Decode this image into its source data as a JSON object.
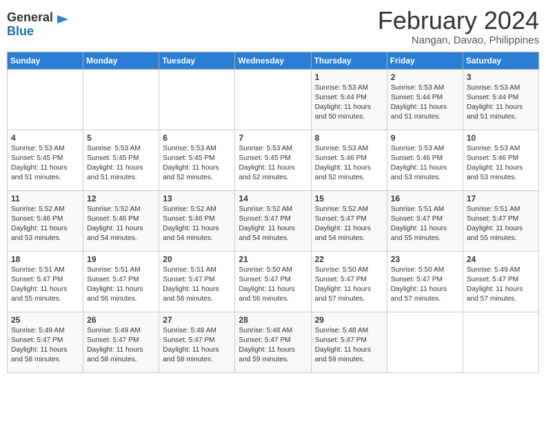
{
  "header": {
    "logo_general": "General",
    "logo_blue": "Blue",
    "month_title": "February 2024",
    "location": "Nangan, Davao, Philippines"
  },
  "weekdays": [
    "Sunday",
    "Monday",
    "Tuesday",
    "Wednesday",
    "Thursday",
    "Friday",
    "Saturday"
  ],
  "weeks": [
    [
      {
        "day": "",
        "info": ""
      },
      {
        "day": "",
        "info": ""
      },
      {
        "day": "",
        "info": ""
      },
      {
        "day": "",
        "info": ""
      },
      {
        "day": "1",
        "info": "Sunrise: 5:53 AM\nSunset: 5:44 PM\nDaylight: 11 hours\nand 50 minutes."
      },
      {
        "day": "2",
        "info": "Sunrise: 5:53 AM\nSunset: 5:44 PM\nDaylight: 11 hours\nand 51 minutes."
      },
      {
        "day": "3",
        "info": "Sunrise: 5:53 AM\nSunset: 5:44 PM\nDaylight: 11 hours\nand 51 minutes."
      }
    ],
    [
      {
        "day": "4",
        "info": "Sunrise: 5:53 AM\nSunset: 5:45 PM\nDaylight: 11 hours\nand 51 minutes."
      },
      {
        "day": "5",
        "info": "Sunrise: 5:53 AM\nSunset: 5:45 PM\nDaylight: 11 hours\nand 51 minutes."
      },
      {
        "day": "6",
        "info": "Sunrise: 5:53 AM\nSunset: 5:45 PM\nDaylight: 11 hours\nand 52 minutes."
      },
      {
        "day": "7",
        "info": "Sunrise: 5:53 AM\nSunset: 5:45 PM\nDaylight: 11 hours\nand 52 minutes."
      },
      {
        "day": "8",
        "info": "Sunrise: 5:53 AM\nSunset: 5:46 PM\nDaylight: 11 hours\nand 52 minutes."
      },
      {
        "day": "9",
        "info": "Sunrise: 5:53 AM\nSunset: 5:46 PM\nDaylight: 11 hours\nand 53 minutes."
      },
      {
        "day": "10",
        "info": "Sunrise: 5:53 AM\nSunset: 5:46 PM\nDaylight: 11 hours\nand 53 minutes."
      }
    ],
    [
      {
        "day": "11",
        "info": "Sunrise: 5:52 AM\nSunset: 5:46 PM\nDaylight: 11 hours\nand 53 minutes."
      },
      {
        "day": "12",
        "info": "Sunrise: 5:52 AM\nSunset: 5:46 PM\nDaylight: 11 hours\nand 54 minutes."
      },
      {
        "day": "13",
        "info": "Sunrise: 5:52 AM\nSunset: 5:46 PM\nDaylight: 11 hours\nand 54 minutes."
      },
      {
        "day": "14",
        "info": "Sunrise: 5:52 AM\nSunset: 5:47 PM\nDaylight: 11 hours\nand 54 minutes."
      },
      {
        "day": "15",
        "info": "Sunrise: 5:52 AM\nSunset: 5:47 PM\nDaylight: 11 hours\nand 54 minutes."
      },
      {
        "day": "16",
        "info": "Sunrise: 5:51 AM\nSunset: 5:47 PM\nDaylight: 11 hours\nand 55 minutes."
      },
      {
        "day": "17",
        "info": "Sunrise: 5:51 AM\nSunset: 5:47 PM\nDaylight: 11 hours\nand 55 minutes."
      }
    ],
    [
      {
        "day": "18",
        "info": "Sunrise: 5:51 AM\nSunset: 5:47 PM\nDaylight: 11 hours\nand 55 minutes."
      },
      {
        "day": "19",
        "info": "Sunrise: 5:51 AM\nSunset: 5:47 PM\nDaylight: 11 hours\nand 56 minutes."
      },
      {
        "day": "20",
        "info": "Sunrise: 5:51 AM\nSunset: 5:47 PM\nDaylight: 11 hours\nand 56 minutes."
      },
      {
        "day": "21",
        "info": "Sunrise: 5:50 AM\nSunset: 5:47 PM\nDaylight: 11 hours\nand 56 minutes."
      },
      {
        "day": "22",
        "info": "Sunrise: 5:50 AM\nSunset: 5:47 PM\nDaylight: 11 hours\nand 57 minutes."
      },
      {
        "day": "23",
        "info": "Sunrise: 5:50 AM\nSunset: 5:47 PM\nDaylight: 11 hours\nand 57 minutes."
      },
      {
        "day": "24",
        "info": "Sunrise: 5:49 AM\nSunset: 5:47 PM\nDaylight: 11 hours\nand 57 minutes."
      }
    ],
    [
      {
        "day": "25",
        "info": "Sunrise: 5:49 AM\nSunset: 5:47 PM\nDaylight: 11 hours\nand 58 minutes."
      },
      {
        "day": "26",
        "info": "Sunrise: 5:49 AM\nSunset: 5:47 PM\nDaylight: 11 hours\nand 58 minutes."
      },
      {
        "day": "27",
        "info": "Sunrise: 5:48 AM\nSunset: 5:47 PM\nDaylight: 11 hours\nand 58 minutes."
      },
      {
        "day": "28",
        "info": "Sunrise: 5:48 AM\nSunset: 5:47 PM\nDaylight: 11 hours\nand 59 minutes."
      },
      {
        "day": "29",
        "info": "Sunrise: 5:48 AM\nSunset: 5:47 PM\nDaylight: 11 hours\nand 59 minutes."
      },
      {
        "day": "",
        "info": ""
      },
      {
        "day": "",
        "info": ""
      }
    ]
  ]
}
